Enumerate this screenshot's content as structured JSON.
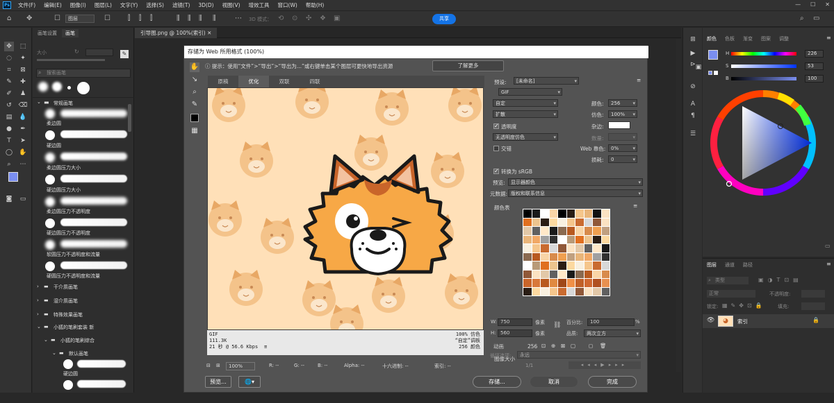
{
  "app": {
    "logo": "Ps",
    "menu": [
      "文件(F)",
      "编辑(E)",
      "图像(I)",
      "图层(L)",
      "文字(Y)",
      "选择(S)",
      "滤镜(T)",
      "3D(D)",
      "视图(V)",
      "增效工具",
      "窗口(W)",
      "帮助(H)"
    ],
    "share_label": "共享",
    "options": {
      "layer_select": "图层",
      "mode_3d": "3D 模式："
    }
  },
  "left_panel": {
    "tabs": [
      "画笔设置",
      "画笔"
    ],
    "size_label": "大小",
    "search_placeholder": "搜索画笔",
    "group_open": "常规画笔",
    "brushes": [
      "柔边圆",
      "硬边圆",
      "柔边圆压力大小",
      "硬边圆压力大小",
      "柔边圆压力不透明度",
      "硬边圆压力不透明度",
      "软圆压力不透明度和流量",
      "硬圆压力不透明度和流量"
    ],
    "folders": [
      "干介质画笔",
      "湿介质画笔",
      "特殊效果画笔",
      "小狐的笔刷套装 新",
      "小狐的笔刷综合",
      "默认画笔"
    ],
    "last_brush": "硬边圆"
  },
  "document": {
    "tab": "引导图.png @ 100%(索引)"
  },
  "dialog": {
    "title": "存储为 Web 所用格式 (100%)",
    "hint": "提示：使用“文件”>“导出”>“导出为...”或右键单击某个图层可更快地导出资源",
    "learn_more": "了解更多",
    "tabs": [
      "原稿",
      "优化",
      "双联",
      "四联"
    ],
    "info_left": [
      "GIF",
      "111.3K",
      "21 秒 @ 56.6 Kbps"
    ],
    "info_right": [
      "100% 仿色",
      "“自定”调板",
      "256 颜色"
    ],
    "bottom": {
      "zoom": "100%",
      "r": "R: --",
      "g": "G: --",
      "b": "B: --",
      "alpha": "Alpha: --",
      "hex": "十六进制: --",
      "index": "索引: --"
    },
    "buttons": {
      "preview": "预览...",
      "save": "存储...",
      "cancel": "取消",
      "done": "完成"
    },
    "settings": {
      "preset_label": "预设:",
      "preset_value": "[未命名]",
      "format": "GIF",
      "palette": "自定",
      "dither": "扩散",
      "colors_label": "颜色:",
      "colors_value": "256",
      "dither_label": "仿色:",
      "dither_value": "100%",
      "transparency_label": "透明度",
      "matte_label": "杂边:",
      "transparency_dither": "无透明度仿色",
      "amount_label": "数量:",
      "interlaced_label": "交错",
      "web_snap_label": "Web 靠色:",
      "web_snap_value": "0%",
      "lossy_label": "损耗:",
      "lossy_value": "0",
      "convert_srgb": "转换为 sRGB",
      "preview_label": "预览:",
      "preview_value": "显示器颜色",
      "metadata_label": "元数据:",
      "metadata_value": "版权和联系信息",
      "color_table_label": "颜色表",
      "color_count": "256",
      "image_size_label": "图像大小",
      "w_label": "W:",
      "w_value": "750",
      "h_label": "H:",
      "h_value": "560",
      "px": "像素",
      "percent_label": "百分比:",
      "percent_value": "100",
      "percent_unit": "%",
      "quality_label": "品质:",
      "quality_value": "两次立方",
      "animation_label": "动画",
      "loop_label": "循环选项:",
      "loop_value": "永远",
      "frame": "1/1"
    }
  },
  "color_panel": {
    "tabs": [
      "颜色",
      "色板",
      "渐变",
      "图案",
      "调整"
    ],
    "h_label": "H",
    "h_value": "226",
    "s_label": "S",
    "s_value": "53",
    "b_label": "B",
    "b_value": "100",
    "foreground": "#7a8ef0"
  },
  "layers_panel": {
    "tabs": [
      "图层",
      "通道",
      "路径"
    ],
    "kind_placeholder": "类型",
    "blend": "正常",
    "opacity_label": "不透明度:",
    "lock_label": "锁定:",
    "fill_label": "填充:",
    "layer_name": "索引"
  },
  "palette": [
    "#f9d5a7",
    "#f5c68c",
    "#e9b57a",
    "#fbe2c2",
    "#ffffff",
    "#1a1a1a",
    "#2a1d14",
    "#d88b4b",
    "#c96b30",
    "#f1a866"
  ]
}
